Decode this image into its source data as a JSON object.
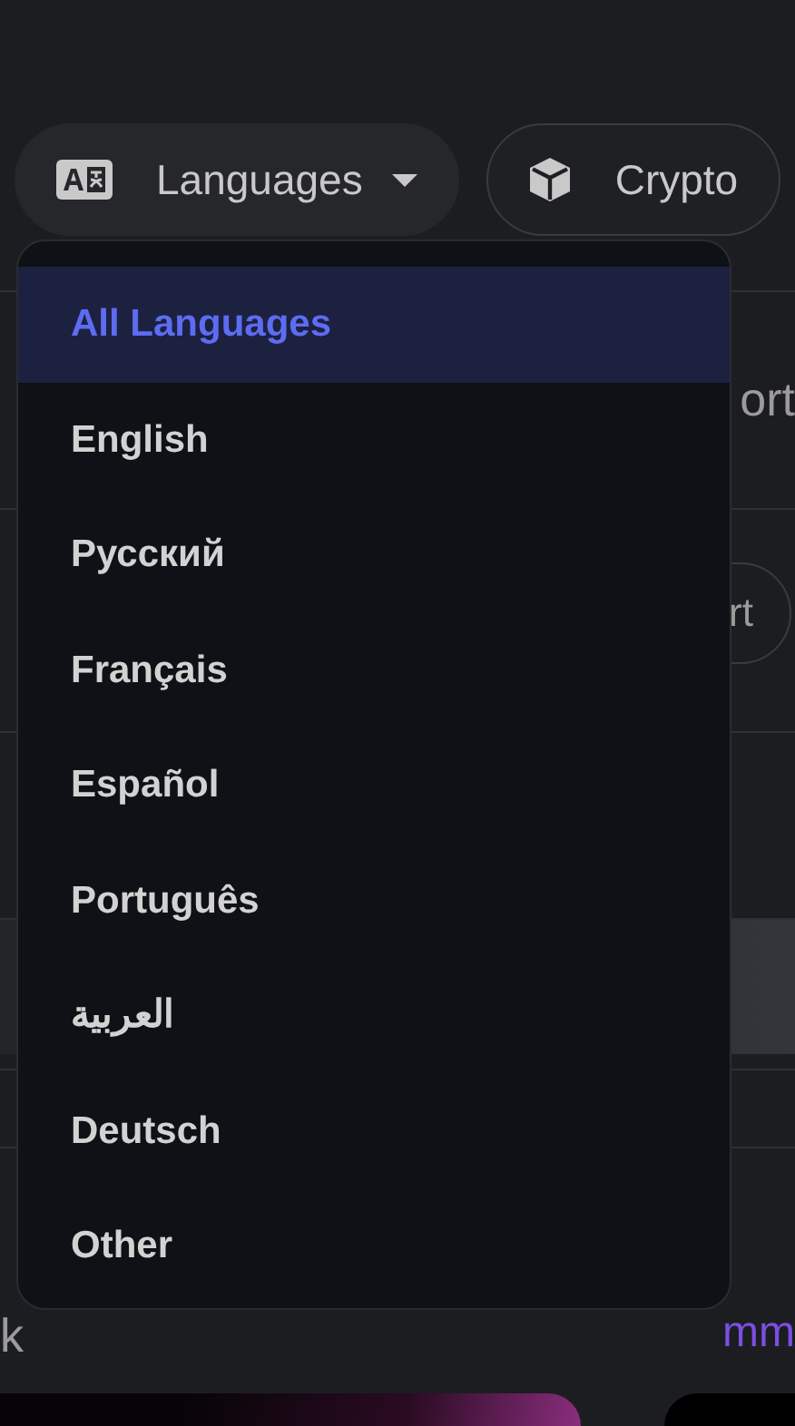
{
  "filters": [
    {
      "kind": "dropdown",
      "label": "Languages",
      "expanded": true
    },
    {
      "kind": "plain",
      "label": "Crypto"
    }
  ],
  "language_menu": {
    "items": [
      {
        "label": "All Languages",
        "selected": true
      },
      {
        "label": "English",
        "selected": false
      },
      {
        "label": "Русский",
        "selected": false
      },
      {
        "label": "Français",
        "selected": false
      },
      {
        "label": "Español",
        "selected": false
      },
      {
        "label": "Português",
        "selected": false
      },
      {
        "label": "العربية",
        "selected": false
      },
      {
        "label": "Deutsch",
        "selected": false
      },
      {
        "label": "Other",
        "selected": false
      }
    ]
  },
  "rows_behind_menu": [
    {
      "kind": "heading",
      "right": "ort"
    },
    {
      "kind": "button",
      "right": "rt"
    },
    {
      "kind": "title"
    },
    {
      "kind": "highlight"
    },
    {
      "kind": "spacer"
    },
    {
      "kind": "links",
      "left": "k",
      "right": "mm"
    }
  ]
}
